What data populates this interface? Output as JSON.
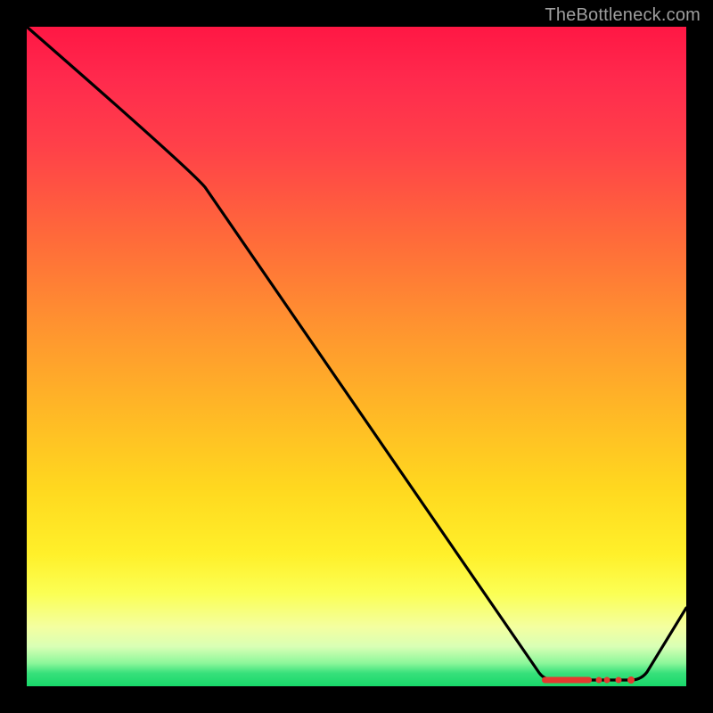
{
  "attribution": "TheBottleneck.com",
  "chart_data": {
    "type": "line",
    "title": "",
    "xlabel": "",
    "ylabel": "",
    "xlim": [
      0,
      100
    ],
    "ylim": [
      0,
      100
    ],
    "x": [
      0,
      25,
      78,
      92,
      100
    ],
    "values": [
      100,
      78,
      0,
      0,
      12
    ],
    "series": [
      {
        "name": "curve",
        "x": [
          0,
          25,
          78,
          92,
          100
        ],
        "values": [
          100,
          78,
          0,
          0,
          12
        ]
      }
    ],
    "markers": {
      "x_range": [
        78,
        92
      ],
      "y": 0,
      "color": "#e5392f",
      "count": 12
    },
    "gradient_stops": [
      {
        "pct": 0,
        "color": "#ff1744"
      },
      {
        "pct": 45,
        "color": "#ff9230"
      },
      {
        "pct": 80,
        "color": "#fff02a"
      },
      {
        "pct": 100,
        "color": "#18d86a"
      }
    ]
  }
}
